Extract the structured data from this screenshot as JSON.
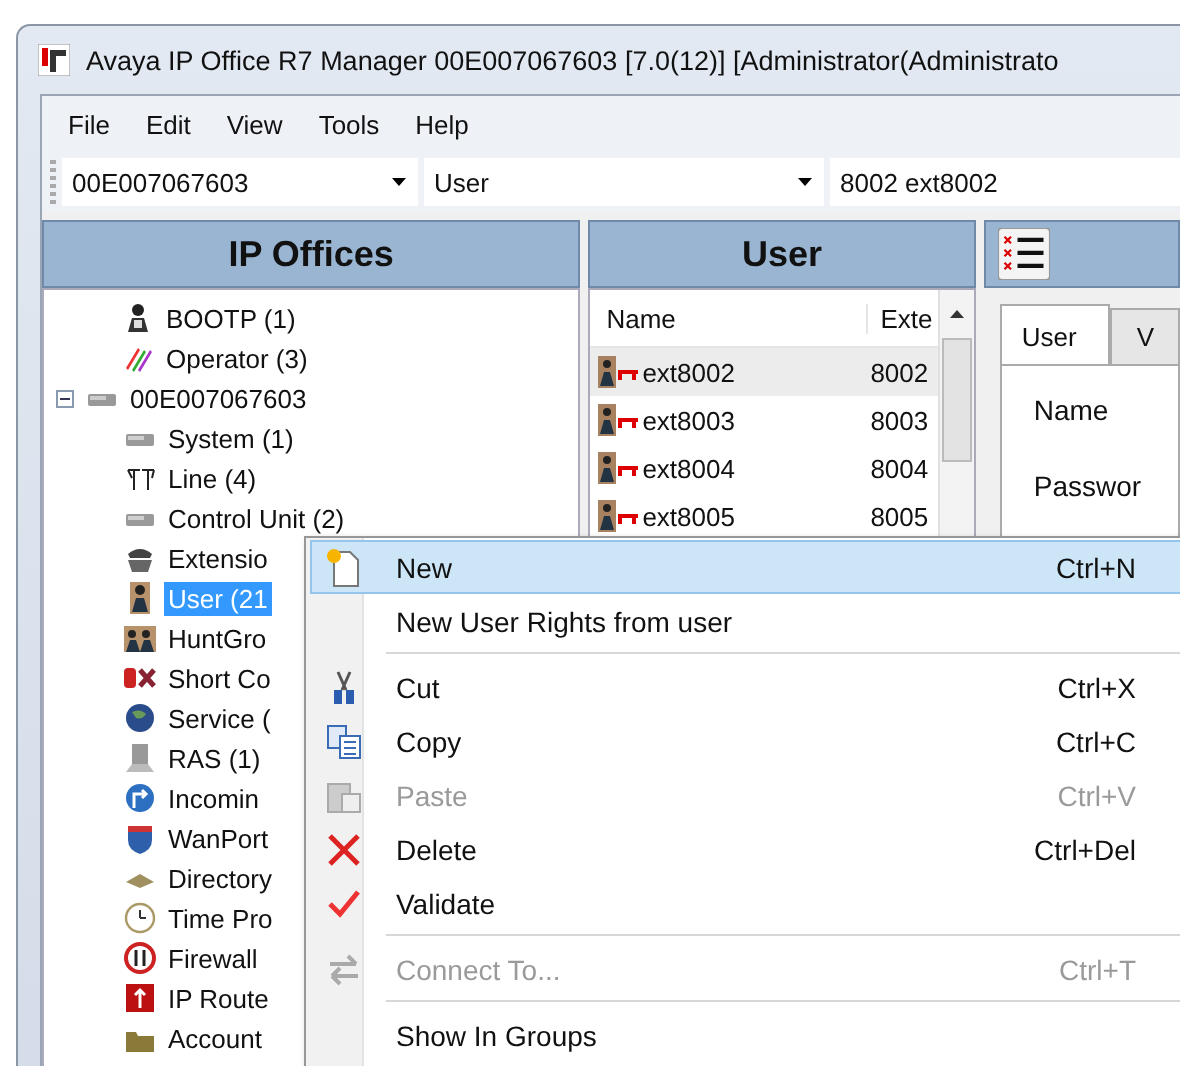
{
  "window": {
    "title": "Avaya IP Office R7 Manager 00E007067603 [7.0(12)] [Administrator(Administrato"
  },
  "menu_bar": [
    "File",
    "Edit",
    "View",
    "Tools",
    "Help"
  ],
  "toolbar": {
    "combos": [
      {
        "value": "00E007067603"
      },
      {
        "value": "User"
      },
      {
        "value": "8002 ext8002"
      }
    ]
  },
  "ip_offices": {
    "title": "IP Offices",
    "tree": [
      {
        "label": "BOOTP (1)",
        "selected": false
      },
      {
        "label": "Operator (3)",
        "selected": false
      },
      {
        "label": "00E007067603",
        "selected": false,
        "expanded": true,
        "children": [
          {
            "label": "System (1)",
            "selected": false
          },
          {
            "label": "Line (4)",
            "selected": false
          },
          {
            "label": "Control Unit (2)",
            "selected": false
          },
          {
            "label": "Extensio",
            "selected": false
          },
          {
            "label": "User (21",
            "selected": true
          },
          {
            "label": "HuntGro",
            "selected": false
          },
          {
            "label": "Short Co",
            "selected": false
          },
          {
            "label": "Service (",
            "selected": false
          },
          {
            "label": "RAS (1)",
            "selected": false
          },
          {
            "label": "Incomin",
            "selected": false
          },
          {
            "label": "WanPort",
            "selected": false
          },
          {
            "label": "Directory",
            "selected": false
          },
          {
            "label": "Time Pro",
            "selected": false
          },
          {
            "label": "Firewall",
            "selected": false
          },
          {
            "label": "IP Route",
            "selected": false
          },
          {
            "label": "Account",
            "selected": false
          }
        ]
      }
    ]
  },
  "user_list": {
    "title": "User",
    "columns": [
      "Name",
      "Exte"
    ],
    "rows": [
      {
        "name": "ext8002",
        "extension": "8002",
        "selected": true
      },
      {
        "name": "ext8003",
        "extension": "8003",
        "selected": false
      },
      {
        "name": "ext8004",
        "extension": "8004",
        "selected": false
      },
      {
        "name": "ext8005",
        "extension": "8005",
        "selected": false
      }
    ]
  },
  "details": {
    "tabs": [
      {
        "label": "User",
        "selected": true
      },
      {
        "label": "V",
        "selected": false
      }
    ],
    "fields": [
      "Name",
      "Passwor"
    ]
  },
  "context_menu": {
    "items": [
      {
        "kind": "item",
        "label": "New",
        "shortcut": "Ctrl+N",
        "selected": true,
        "disabled": false
      },
      {
        "kind": "item",
        "label": "New User Rights from user",
        "selected": false,
        "disabled": false
      },
      {
        "kind": "separator"
      },
      {
        "kind": "item",
        "label": "Cut",
        "shortcut": "Ctrl+X",
        "selected": false,
        "disabled": false
      },
      {
        "kind": "item",
        "label": "Copy",
        "shortcut": "Ctrl+C",
        "selected": false,
        "disabled": false
      },
      {
        "kind": "item",
        "label": "Paste",
        "shortcut": "Ctrl+V",
        "selected": false,
        "disabled": true
      },
      {
        "kind": "item",
        "label": "Delete",
        "shortcut": "Ctrl+Del",
        "selected": false,
        "disabled": false
      },
      {
        "kind": "item",
        "label": "Validate",
        "selected": false,
        "disabled": false
      },
      {
        "kind": "separator"
      },
      {
        "kind": "item",
        "label": "Connect To...",
        "shortcut": "Ctrl+T",
        "selected": false,
        "disabled": true
      },
      {
        "kind": "separator"
      },
      {
        "kind": "item",
        "label": "Show In Groups",
        "selected": false
      }
    ]
  }
}
